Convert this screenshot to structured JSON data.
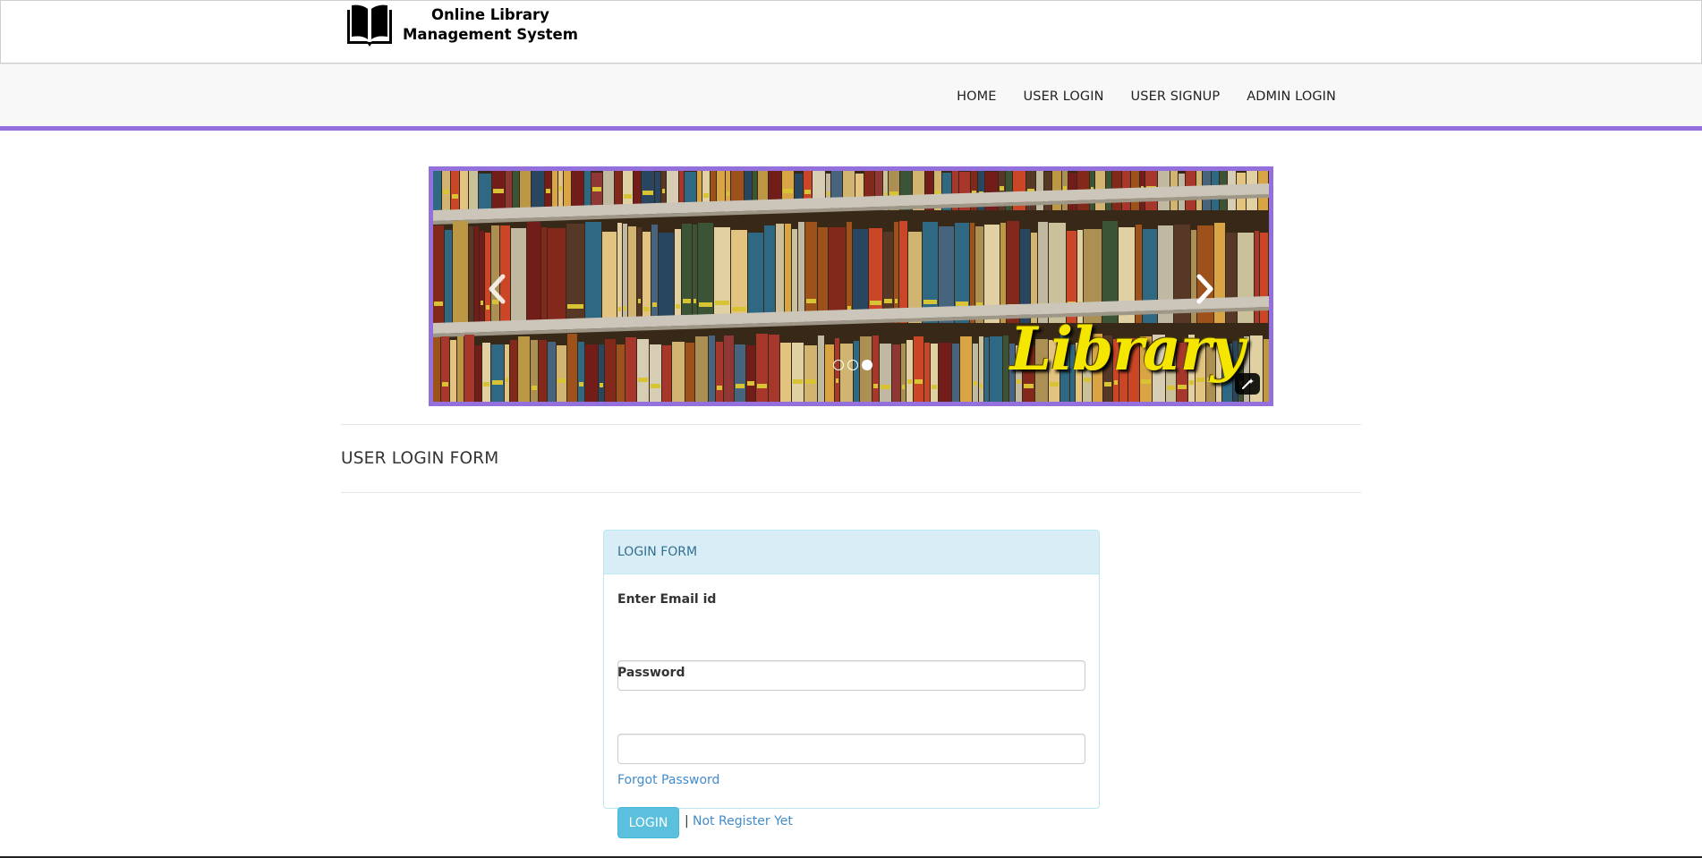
{
  "brand": {
    "title_line1": "Online Library",
    "title_line2": "Management System",
    "icon": "open-book-icon"
  },
  "nav": {
    "items": [
      {
        "label": "HOME"
      },
      {
        "label": "USER LOGIN"
      },
      {
        "label": "USER SIGNUP"
      },
      {
        "label": "ADMIN LOGIN"
      }
    ]
  },
  "carousel": {
    "caption": "Library",
    "slide_count": 3,
    "active_slide": 3,
    "accent_color": "#9370db",
    "prev_icon": "chevron-left-icon",
    "next_icon": "chevron-right-icon"
  },
  "page": {
    "section_title": "USER LOGIN FORM"
  },
  "login_form": {
    "heading": "LOGIN FORM",
    "email_label": "Enter Email id",
    "email_value": "",
    "password_label": "Password",
    "password_value": "",
    "forgot_link": "Forgot Password",
    "login_button": "LOGIN",
    "separator": "|",
    "register_link": "Not Register Yet"
  },
  "colors": {
    "accent": "#9370db",
    "panel_heading_bg": "#d9edf7",
    "button_info": "#5bc0de",
    "link": "#428bca"
  }
}
